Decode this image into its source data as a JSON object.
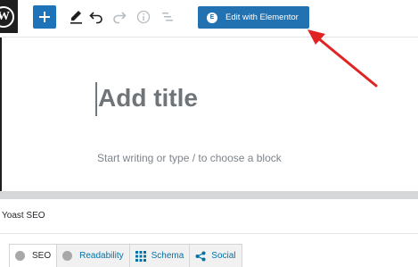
{
  "toolbar": {
    "logo_glyph": "W",
    "elementor_badge": "E",
    "elementor_button_label": "Edit with Elementor",
    "colors": {
      "primary": "#2271b1",
      "add_button": "#1e73b8",
      "arrow": "#e02424"
    }
  },
  "editor": {
    "title_placeholder": "Add title",
    "block_hint": "Start writing or type / to choose a block"
  },
  "yoast": {
    "title": "Yoast SEO",
    "tabs": [
      {
        "label": "SEO",
        "icon": "status-dot-icon"
      },
      {
        "label": "Readability",
        "icon": "status-dot-icon"
      },
      {
        "label": "Schema",
        "icon": "grid-icon"
      },
      {
        "label": "Social",
        "icon": "share-icon"
      }
    ]
  }
}
